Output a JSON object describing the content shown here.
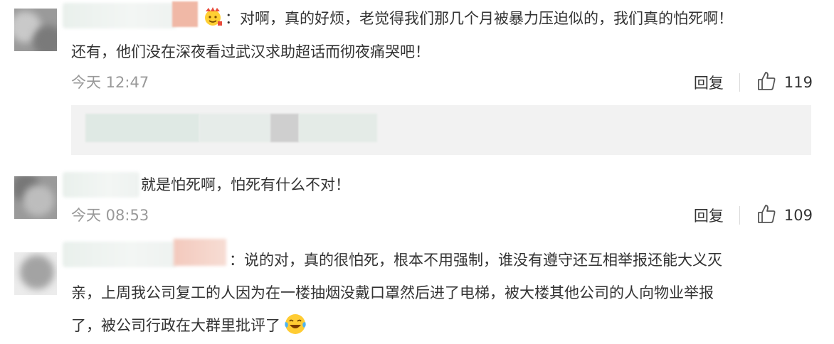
{
  "comments": [
    {
      "text_line1": "：对啊，真的好烦，老觉得我们那几个月被暴力压迫似的，我们真的怕死啊！",
      "text_line2": "还有，他们没在深夜看过武汉求助超话而彻夜痛哭吧！",
      "time": "今天 12:47",
      "reply_label": "回复",
      "likes": "119",
      "badge_icon": "crown-emoji-icon"
    },
    {
      "text_line1": "就是怕死啊，怕死有什么不对！",
      "time": "今天 08:53",
      "reply_label": "回复",
      "likes": "109"
    },
    {
      "text_line1": "：说的对，真的很怕死，根本不用强制，谁没有遵守还互相举报还能大义灭",
      "text_line2": "亲，上周我公司复工的人因为在一楼抽烟没戴口罩然后进了电梯，被大楼其他公司的人向物业举报",
      "text_line3": "了，被公司行政在大群里批评了",
      "trailing_icon": "tears-of-joy-emoji-icon"
    }
  ],
  "colors": {
    "text": "#333333",
    "meta": "#999999",
    "quote_bg": "#f2f2f2"
  }
}
